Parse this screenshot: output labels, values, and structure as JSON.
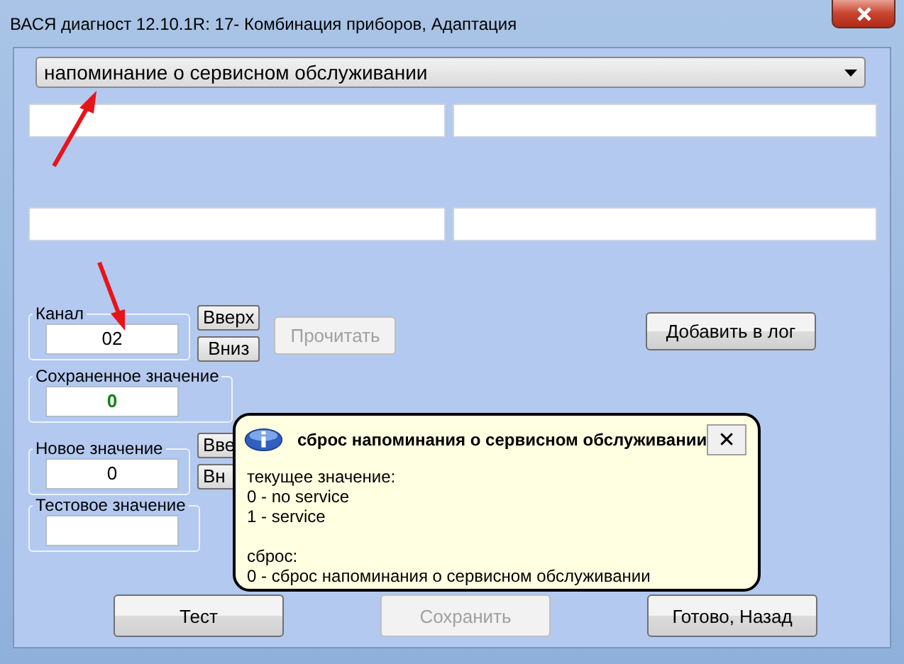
{
  "window": {
    "title": "ВАСЯ диагност 12.10.1R: 17- Комбинация приборов, Адаптация"
  },
  "parameter_dropdown": {
    "value": "напоминание о сервисном обслуживании"
  },
  "channel": {
    "label": "Канал",
    "value": "02",
    "buttons": [
      "Вверх",
      "Вниз"
    ]
  },
  "read_button": {
    "label": "Прочитать",
    "disabled": true
  },
  "add_to_log_button": {
    "label": "Добавить в лог",
    "disabled": false
  },
  "saved_value": {
    "label": "Сохраненное значение",
    "value": "0"
  },
  "new_value": {
    "label": "Новое значение",
    "value": "0",
    "buttons": [
      "Вве",
      "Вн"
    ]
  },
  "test_value": {
    "label": "Тестовое значение"
  },
  "footer_buttons": [
    {
      "label": "Тест",
      "disabled": false
    },
    {
      "label": "Сохранить",
      "disabled": true
    },
    {
      "label": "Готово, Назад",
      "disabled": false
    }
  ],
  "tooltip": {
    "title": "сброс напоминания о сервисном обслуживании",
    "close": "✕",
    "paragraphs": [
      [
        "текущее значение:",
        "0 - no service",
        "1 - service"
      ],
      [
        "сброс:",
        "0 - сброс напоминания о сервисном обслуживании"
      ]
    ]
  }
}
